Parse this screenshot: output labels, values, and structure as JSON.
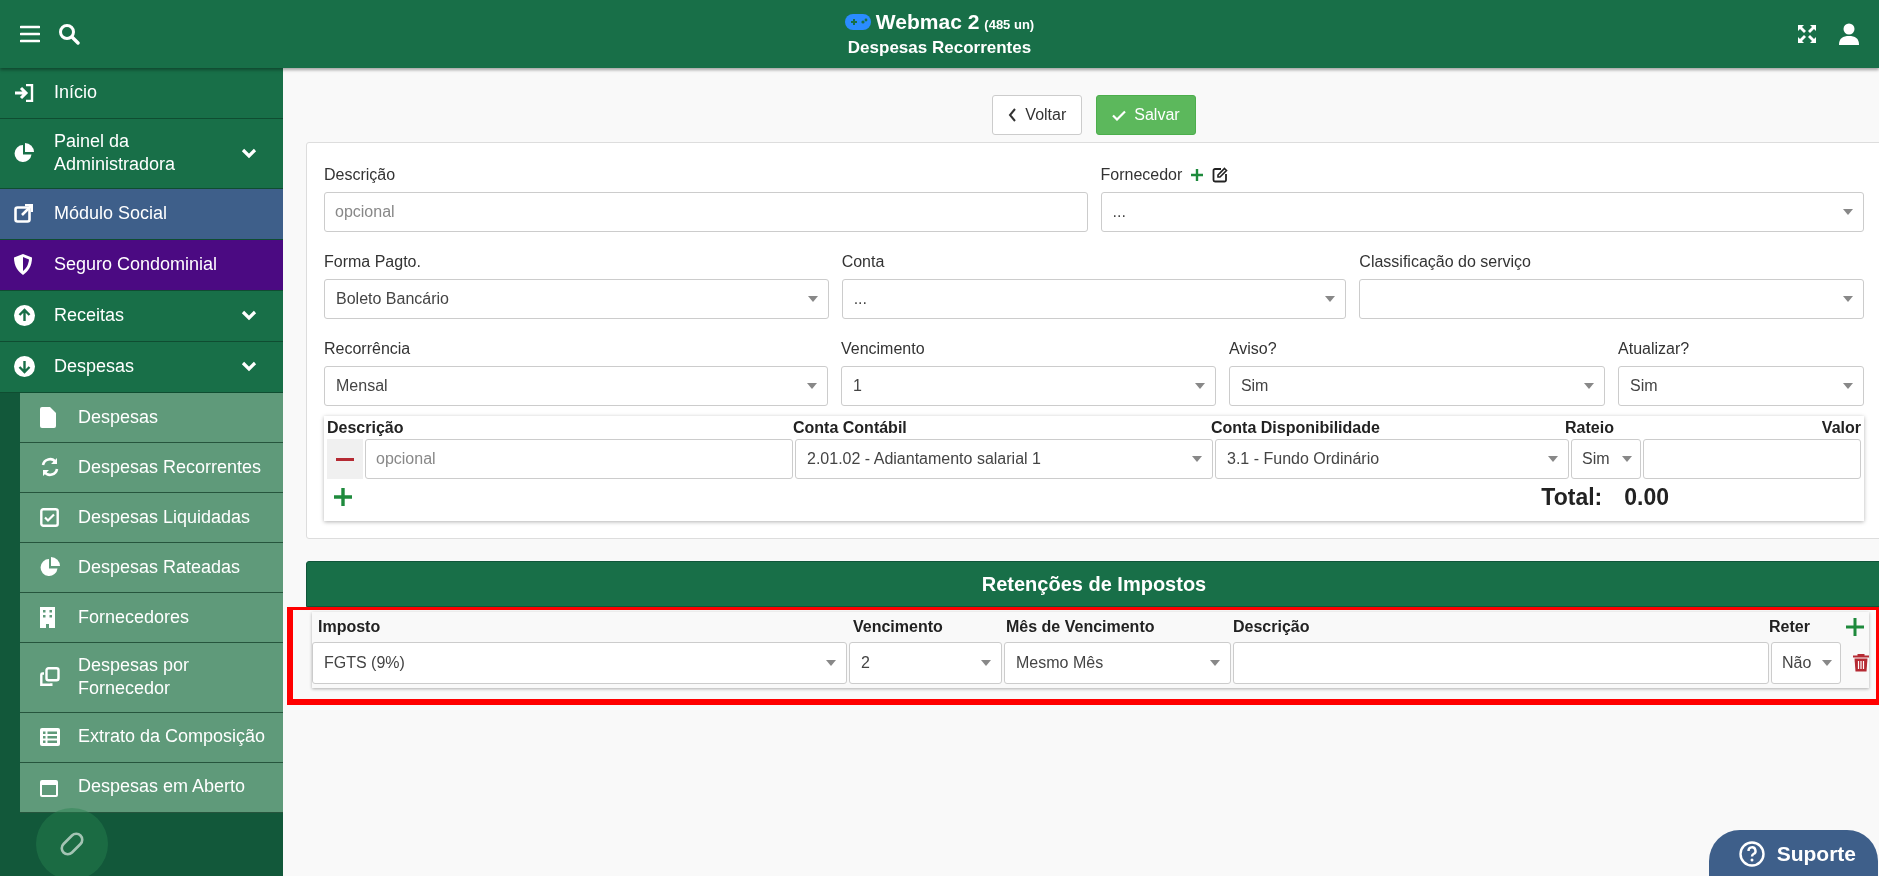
{
  "header": {
    "title": "Webmac 2",
    "count": "(485 un)",
    "subtitle": "Despesas Recorrentes"
  },
  "sidebar": {
    "items": [
      {
        "label": "Início",
        "color": "#186f48",
        "expandable": false
      },
      {
        "label": "Painel da Administradora",
        "color": "#186f48",
        "expandable": true
      },
      {
        "label": "Módulo Social",
        "color": "#3e5f8a",
        "expandable": false
      },
      {
        "label": "Seguro Condominial",
        "color": "#4b0a82",
        "expandable": false
      },
      {
        "label": "Receitas",
        "color": "#186f48",
        "expandable": true
      },
      {
        "label": "Despesas",
        "color": "#186f48",
        "expandable": true,
        "children": [
          {
            "label": "Despesas"
          },
          {
            "label": "Despesas Recorrentes"
          },
          {
            "label": "Despesas Liquidadas"
          },
          {
            "label": "Despesas Rateadas"
          },
          {
            "label": "Fornecedores"
          },
          {
            "label": "Despesas por Fornecedor"
          },
          {
            "label": "Extrato da Composição"
          },
          {
            "label": "Despesas em Aberto"
          }
        ]
      }
    ]
  },
  "buttons": [
    {
      "label": "Voltar",
      "kind": "back"
    },
    {
      "label": "Salvar",
      "kind": "save"
    }
  ],
  "form": {
    "rows": [
      [
        {
          "label": "Descrição",
          "kind": "text",
          "placeholder": "opcional"
        },
        {
          "label": "Fornecedor",
          "kind": "lookup",
          "value": "..."
        }
      ],
      [
        {
          "label": "Forma Pagto.",
          "kind": "select",
          "value": "Boleto Bancário"
        },
        {
          "label": "Conta",
          "kind": "select",
          "value": "..."
        },
        {
          "label": "Classificação do serviço",
          "kind": "select"
        }
      ],
      [
        {
          "label": "Recorrência",
          "kind": "select",
          "value": "Mensal"
        },
        {
          "label": "Vencimento",
          "kind": "select",
          "value": "1"
        },
        {
          "label": "Aviso?",
          "kind": "select",
          "value": "Sim"
        },
        {
          "label": "Atualizar?",
          "kind": "select",
          "value": "Sim"
        }
      ]
    ]
  },
  "apportionment": {
    "columns": [
      "Descrição",
      "Conta Contábil",
      "Conta Disponibilidade",
      "Rateio",
      "Valor"
    ],
    "rows": [
      {
        "description_placeholder": "opcional",
        "account": "2.01.02 - Adiantamento salarial 1",
        "availability": "3.1 - Fundo Ordinário",
        "rateio": "Sim"
      }
    ],
    "total_label": "Total:",
    "total": "0.00"
  },
  "retentions": {
    "title": "Retenções de Impostos",
    "columns": [
      "Imposto",
      "Vencimento",
      "Mês de Vencimento",
      "Descrição",
      "Reter"
    ],
    "rows": [
      {
        "tax": "FGTS (9%)",
        "due": "2",
        "month": "Mesmo Mês",
        "reter": "Não"
      }
    ],
    "highlighted": true
  },
  "support": {
    "label": "Suporte"
  }
}
